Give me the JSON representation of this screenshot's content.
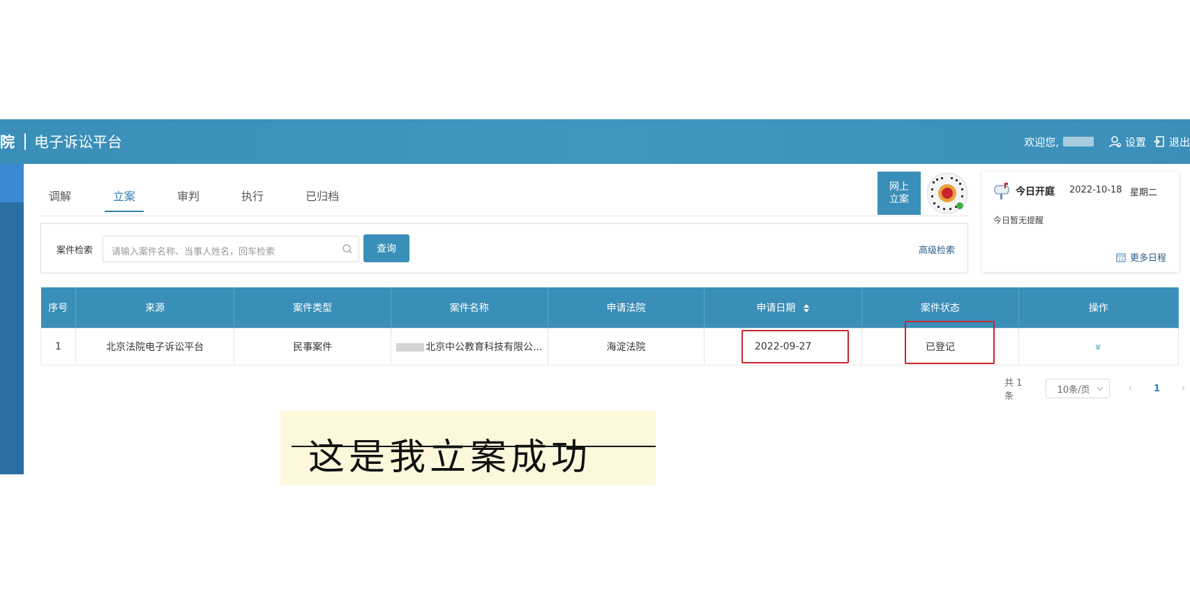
{
  "header": {
    "court_fragment": "院",
    "platform_title": "电子诉讼平台",
    "welcome": "欢迎您,",
    "settings_label": "设置",
    "logout_label": "退出"
  },
  "tabs": [
    {
      "label": "调解",
      "active": false
    },
    {
      "label": "立案",
      "active": true
    },
    {
      "label": "审判",
      "active": false
    },
    {
      "label": "执行",
      "active": false
    },
    {
      "label": "已归档",
      "active": false
    }
  ],
  "online_filing": {
    "line1": "网上",
    "line2": "立案"
  },
  "search": {
    "label": "案件检索",
    "placeholder": "请输入案件名称、当事人姓名，回车检索",
    "button": "查询",
    "advanced": "高级检索"
  },
  "schedule": {
    "title": "今日开庭",
    "date": "2022-10-18",
    "weekday": "星期二",
    "empty": "今日暂无提醒",
    "more": "更多日程"
  },
  "table": {
    "headers": [
      "序号",
      "来源",
      "案件类型",
      "案件名称",
      "申请法院",
      "申请日期",
      "案件状态",
      "操作"
    ],
    "rows": [
      {
        "index": "1",
        "source": "北京法院电子诉讼平台",
        "type": "民事案件",
        "name": "北京中公教育科技有限公...",
        "court": "海淀法院",
        "date": "2022-09-27",
        "status": "已登记",
        "action": "»"
      }
    ]
  },
  "pagination": {
    "total": "共 1 条",
    "page_size": "10条/页",
    "prev": "‹",
    "current": "1",
    "next": "›"
  },
  "annotation": {
    "text": "这是我立案成功"
  },
  "colors": {
    "primary": "#3a8fb8",
    "highlight_box": "#c9252b",
    "note_bg": "#fdf8dc"
  }
}
